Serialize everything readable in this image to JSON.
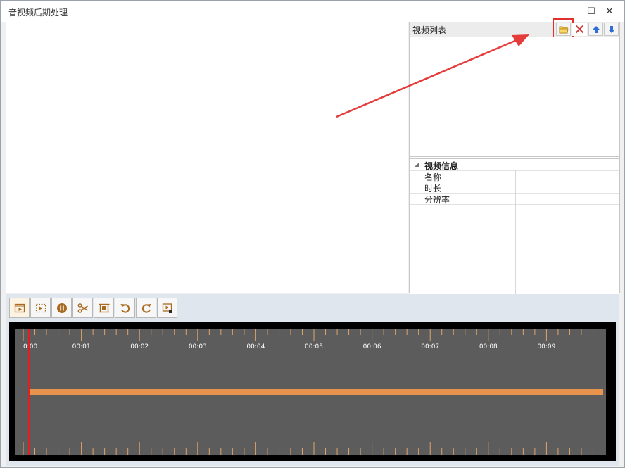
{
  "window": {
    "title": "音视频后期处理",
    "maximize_glyph": "☐",
    "close_glyph": "✕"
  },
  "video_list": {
    "title": "视频列表",
    "buttons": [
      {
        "icon": "open-folder-icon"
      },
      {
        "icon": "delete-x-icon"
      },
      {
        "icon": "move-up-icon"
      },
      {
        "icon": "move-down-icon"
      }
    ]
  },
  "video_info": {
    "category": "视频信息",
    "rows": [
      {
        "name": "名称",
        "value": ""
      },
      {
        "name": "时长",
        "value": ""
      },
      {
        "name": "分辨率",
        "value": ""
      }
    ]
  },
  "toolbar": {
    "tools": [
      {
        "icon": "play-clip-icon"
      },
      {
        "icon": "select-range-icon"
      },
      {
        "icon": "pause-icon"
      },
      {
        "icon": "scissors-icon"
      },
      {
        "icon": "crop-frame-icon"
      },
      {
        "icon": "rotate-left-icon"
      },
      {
        "icon": "rotate-right-icon"
      },
      {
        "icon": "export-video-icon"
      }
    ]
  },
  "timeline": {
    "labels": [
      "0:00",
      "00:01",
      "00:02",
      "00:03",
      "00:04",
      "00:05",
      "00:06",
      "00:07",
      "00:08",
      "00:09"
    ],
    "playhead_position": 0,
    "clip_start_fraction": 0,
    "clip_end_fraction": 1
  },
  "colors": {
    "accent": "#e03030",
    "clip": "#e8944f",
    "timeline_bg": "#5c5c5c",
    "tool_icon": "#a86a1f"
  }
}
